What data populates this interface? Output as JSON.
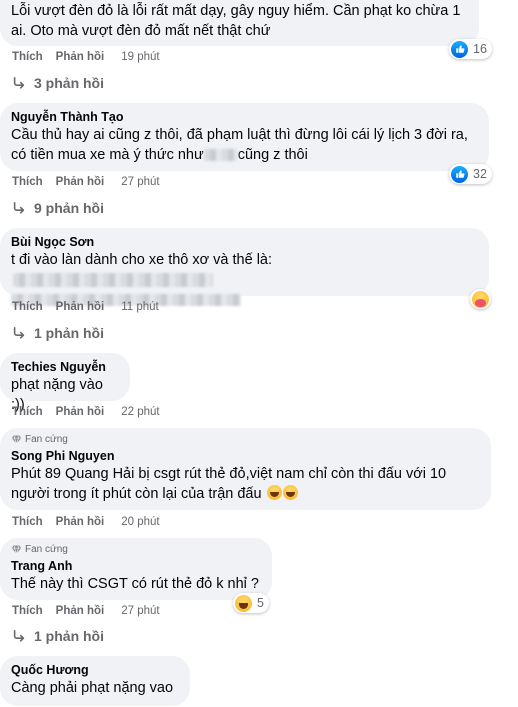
{
  "actions": {
    "like": "Thích",
    "reply": "Phản hồi"
  },
  "comments": [
    {
      "lines": [
        "Lỗi vượt đèn đỏ là lỗi rất mất dạy, gây nguy hiểm. Cần phạt ko chừa 1",
        "ai. Oto mà vượt đèn đỏ mất nết thật chứ"
      ],
      "time": "19 phút",
      "reaction": {
        "type": "like-icon",
        "count": "16"
      },
      "replies": "3 phản hồi"
    },
    {
      "author": "Nguyễn Thành Tạo",
      "lines": [
        "Cầu thủ hay ai cũng z thôi, đã phạm luật thì đừng lôi cái lý lịch 3 đời ra,",
        "có tiền mua xe mà ý thức như",
        "cũng z thôi"
      ],
      "time": "27 phút",
      "reaction": {
        "type": "like-icon",
        "count": "32"
      },
      "replies": "9 phản hồi"
    },
    {
      "author": "Bùi Ngọc Sơn",
      "lines": [
        "t đi vào làn dành cho xe thô xơ và thế là:"
      ],
      "time": "11 phút",
      "reaction": {
        "type": "care-icon"
      },
      "replies": "1 phản hồi"
    },
    {
      "author": "Techies Nguyễn",
      "lines": [
        "phạt nặng vào :))"
      ],
      "time": "22 phút"
    },
    {
      "badge": "Fan cứng",
      "author": "Song Phi Nguyen",
      "lines": [
        "Phút 89 Quang Hải bị csgt rút thẻ đỏ,việt nam chỉ còn thi đấu với 10",
        "người trong ít phút còn lại của trận đấu"
      ],
      "time": "20 phút"
    },
    {
      "badge": "Fan cứng",
      "author": "Trang Anh",
      "lines": [
        "Thế này thì CSGT có rút thẻ đỏ k nhỉ ?"
      ],
      "time": "27 phút",
      "reaction": {
        "type": "haha-icon",
        "count": "5"
      },
      "replies": "1 phản hồi"
    },
    {
      "author": "Quốc Hương",
      "lines": [
        "Càng phải phạt nặng vao"
      ]
    }
  ]
}
